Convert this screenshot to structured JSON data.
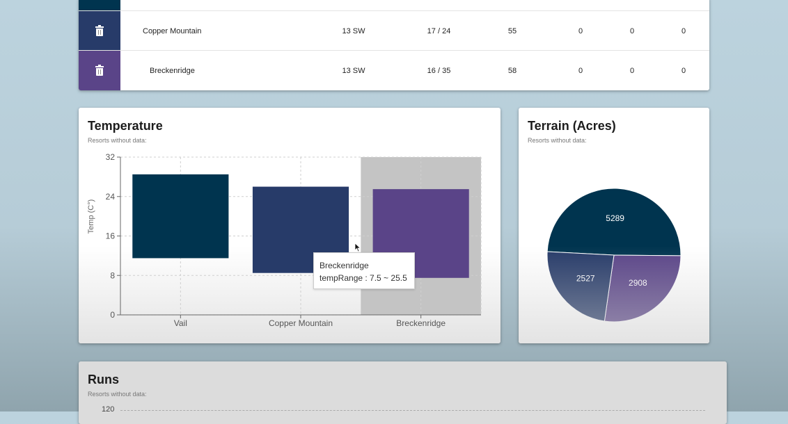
{
  "table": {
    "rows": [
      {
        "color": "#26385f",
        "name": "",
        "dir": "",
        "temp": "",
        "c4": "",
        "c5": "",
        "c6": "",
        "c7": ""
      },
      {
        "color": "#273b69",
        "name": "Copper Mountain",
        "dir": "13 SW",
        "temp": "17 / 24",
        "c4": "55",
        "c5": "0",
        "c6": "0",
        "c7": "0"
      },
      {
        "color": "#5a4488",
        "name": "Breckenridge",
        "dir": "13 SW",
        "temp": "16 / 35",
        "c4": "58",
        "c5": "0",
        "c6": "0",
        "c7": "0"
      }
    ]
  },
  "temperature": {
    "title": "Temperature",
    "subtitle": "Resorts without data:",
    "tooltip": {
      "name": "Breckenridge",
      "label": "tempRange : 7.5 ~ 25.5"
    }
  },
  "terrain": {
    "title": "Terrain (Acres)",
    "subtitle": "Resorts without data:"
  },
  "runs": {
    "title": "Runs",
    "subtitle": "Resorts without data:",
    "first_tick": "120"
  },
  "chart_data": [
    {
      "type": "bar",
      "chart": "temperature",
      "categories": [
        "Vail",
        "Copper Mountain",
        "Breckenridge"
      ],
      "ranges": [
        [
          11.5,
          28.5
        ],
        [
          8.5,
          26.0
        ],
        [
          7.5,
          25.5
        ]
      ],
      "colors": [
        "#00344f",
        "#273b69",
        "#5a4488"
      ],
      "ylabel": "Temp (C°)",
      "ylim": [
        0,
        32
      ],
      "yticks": [
        0,
        8,
        16,
        24,
        32
      ],
      "grid": true,
      "highlighted": "Breckenridge"
    },
    {
      "type": "pie",
      "chart": "terrain",
      "labels": [
        "",
        "",
        ""
      ],
      "values": [
        5289,
        2908,
        2527
      ],
      "colors": [
        "#00344f",
        "#5a4488",
        "#273b69"
      ]
    }
  ]
}
